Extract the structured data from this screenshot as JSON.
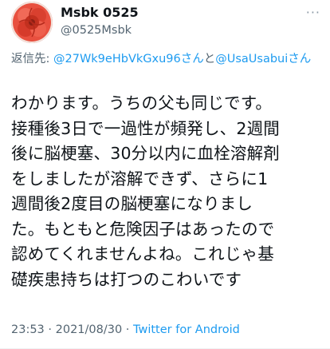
{
  "tweet": {
    "author": {
      "display_name": "Msbk 0525",
      "handle": "@0525Msbk",
      "avatar_icon": "flower-avatar"
    },
    "more_label": "···",
    "reply": {
      "prefix": "返信先: ",
      "mention_1": "@27Wk9eHbVkGxu96さん",
      "joiner": "と",
      "mention_2": "@UsaUsabuiさん"
    },
    "text": "わかります。うちの父も同じです。\n接種後3日で一過性が頻発し、2週間\n後に脳梗塞、30分以内に血栓溶解剤\nをしましたが溶解できず、さらに1\n週間後2度目の脳梗塞になりまし\nた。もともと危険因子はあったので\n認めてくれませんよね。これじゃ基\n礎疾患持ちは打つのこわいです",
    "time": "23:53",
    "date": "2021/08/30",
    "separator": " · ",
    "source": "Twitter for Android",
    "colors": {
      "link": "#1d9bf0",
      "secondary": "#536471",
      "primary": "#0f1419"
    }
  }
}
